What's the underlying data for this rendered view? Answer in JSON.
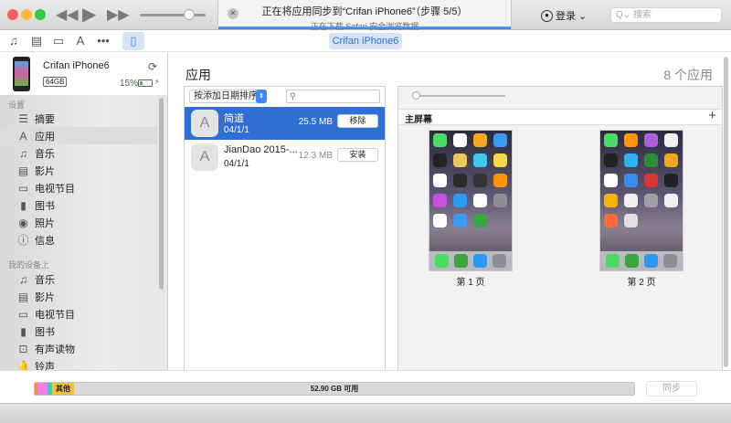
{
  "titlebar": {
    "status_title": "正在将应用同步到“Crifan iPhone6”（步骤 5/5）",
    "status_sub": "正在下载 Safari 安全浏览数据",
    "login": "登录",
    "search_placeholder": "搜索",
    "progress": 1.0,
    "colors": {
      "close": "#fc605c",
      "minimize": "#fdbc40",
      "zoom": "#34c84a",
      "accent": "#2f7ff0"
    }
  },
  "toolbar": {
    "icons": [
      "music-icon",
      "movies-icon",
      "tv-icon",
      "apps-icon",
      "more-icon"
    ],
    "device_button": "Crifan iPhone6"
  },
  "device": {
    "name": "Crifan iPhone6",
    "capacity": "64GB",
    "battery": "15%",
    "battery_level": 0.15
  },
  "sidebar": {
    "settings_header": "设置",
    "settings": [
      {
        "label": "摘要",
        "icon": "☰"
      },
      {
        "label": "应用",
        "icon": "A",
        "selected": true
      },
      {
        "label": "音乐",
        "icon": "♫"
      },
      {
        "label": "影片",
        "icon": "▤"
      },
      {
        "label": "电视节目",
        "icon": "▭"
      },
      {
        "label": "图书",
        "icon": "▮"
      },
      {
        "label": "照片",
        "icon": "◉"
      },
      {
        "label": "信息",
        "icon": "ⓘ"
      }
    ],
    "ondevice_header": "我的设备上",
    "ondevice": [
      {
        "label": "音乐",
        "icon": "♫"
      },
      {
        "label": "影片",
        "icon": "▤"
      },
      {
        "label": "电视节目",
        "icon": "▭"
      },
      {
        "label": "图书",
        "icon": "▮"
      },
      {
        "label": "有声读物",
        "icon": "⊡"
      },
      {
        "label": "铃声",
        "icon": "🔔"
      }
    ]
  },
  "main": {
    "title": "应用",
    "count": "8 个应用",
    "sort": "按添加日期排序",
    "apps": [
      {
        "name": "简道",
        "date": "04/1/1",
        "size": "25.5 MB",
        "action": "移除",
        "selected": true
      },
      {
        "name": "JianDao 2015-...",
        "date": "04/1/1",
        "size": "12.3 MB",
        "action": "安装"
      }
    ],
    "home_title": "主屏幕",
    "pages": [
      {
        "label": "第 1 页",
        "icons": [
          "#4cd964",
          "#ffffff",
          "#f5a623",
          "#3a9bf0",
          "#222222",
          "#e8c95a",
          "#40c8f0",
          "#f5d94a",
          "#ffffff",
          "#2a2a2a",
          "#333333",
          "#ff9500",
          "#c94fe0",
          "#2b9af3",
          "#ffffff",
          "#8e8e93",
          "#ffffff",
          "#3a9bf0",
          "#3aa541"
        ]
      },
      {
        "label": "第 2 页",
        "icons": [
          "#4cd964",
          "#ff9500",
          "#b05ee0",
          "#f0f0f0",
          "#222222",
          "#2bb5f0",
          "#2e8b3a",
          "#f5a623",
          "#ffffff",
          "#3a8df0",
          "#d33",
          "#222222",
          "#f5b400",
          "#f0f0f0",
          "#a0a0a0",
          "#f0f0f0",
          "#ff6a3d",
          "#e0e0e0"
        ]
      }
    ],
    "dock": [
      "#4cd964",
      "#3aa541",
      "#2b9af3",
      "#8e8e93"
    ]
  },
  "storage": {
    "other_label": "其他",
    "free": "52.90 GB 可用",
    "segments": [
      {
        "color": "#f08a5d",
        "share": 0.004
      },
      {
        "color": "#f37ee8",
        "share": 0.017
      },
      {
        "color": "#5ab3f0",
        "share": 0.004
      },
      {
        "color": "#4ccf8f",
        "share": 0.004
      }
    ],
    "sync": "同步"
  }
}
